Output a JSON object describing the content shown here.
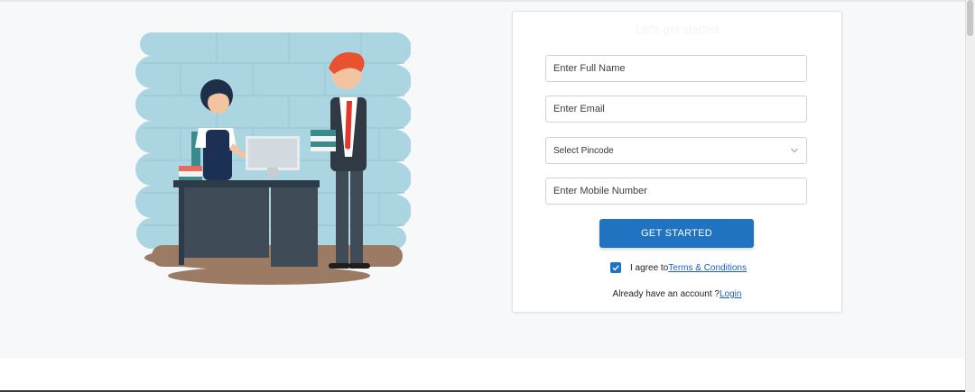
{
  "form": {
    "heading": "Let's get started",
    "full_name_placeholder": "Enter Full Name",
    "email_placeholder": "Enter Email",
    "pincode_select": "Select Pincode",
    "mobile_placeholder": "Enter Mobile Number",
    "cta_label": "GET STARTED",
    "agree_text": "I agree to",
    "terms_link": "Terms & Conditions",
    "login_prompt": "Already have an account ?",
    "login_link": "Login"
  },
  "icons": {
    "pincode_dropdown": "chevron-down-icon",
    "agree_checkbox": "checkmark-icon"
  },
  "colors": {
    "primary": "#1f73c1",
    "link": "#1f5fbf",
    "illustration_bg": "#acd5e2"
  }
}
